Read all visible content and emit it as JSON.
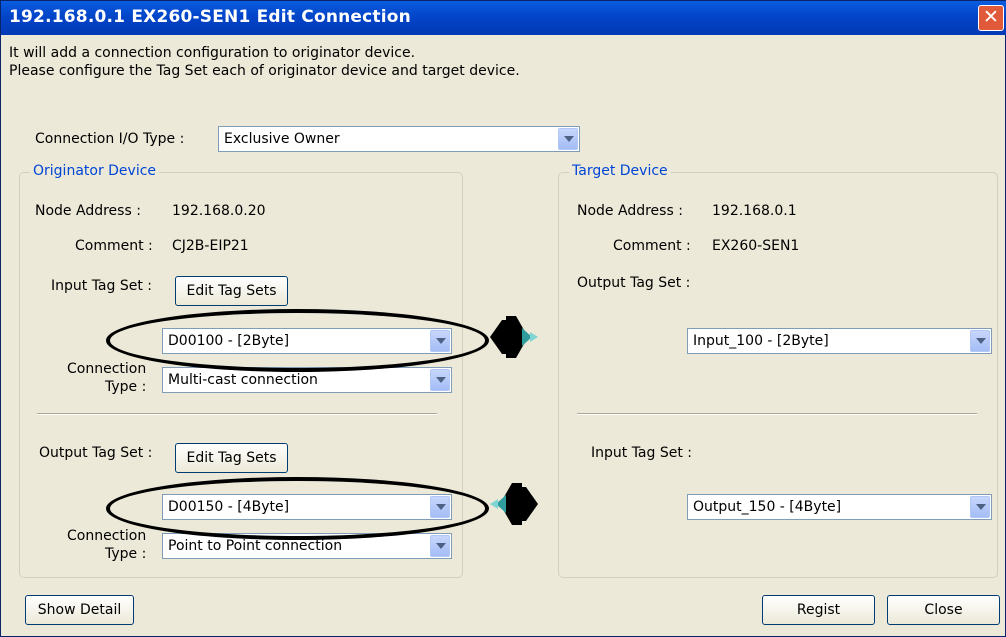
{
  "window": {
    "title": "192.168.0.1 EX260-SEN1 Edit Connection",
    "close_glyph": "✕"
  },
  "intro": {
    "line1": "It will add a connection configuration to originator device.",
    "line2": "Please configure the Tag Set each of originator device and target device."
  },
  "connection_io": {
    "label": "Connection I/O Type :",
    "value": "Exclusive Owner"
  },
  "originator": {
    "title": "Originator Device",
    "node_address_label": "Node Address :",
    "node_address": "192.168.0.20",
    "comment_label": "Comment :",
    "comment": "CJ2B-EIP21",
    "input_tag_set_label": "Input Tag Set :",
    "input_edit_button": "Edit Tag Sets",
    "input_tag_value": "D00100 - [2Byte]",
    "input_conn_type_label1": "Connection",
    "input_conn_type_label2": "Type :",
    "input_conn_type_value": "Multi-cast connection",
    "output_tag_set_label": "Output Tag Set :",
    "output_edit_button": "Edit Tag Sets",
    "output_tag_value": "D00150 - [4Byte]",
    "output_conn_type_label1": "Connection",
    "output_conn_type_label2": "Type :",
    "output_conn_type_value": "Point to Point connection"
  },
  "target": {
    "title": "Target Device",
    "node_address_label": "Node Address :",
    "node_address": "192.168.0.1",
    "comment_label": "Comment :",
    "comment": "EX260-SEN1",
    "output_tag_set_label": "Output Tag Set :",
    "output_tag_value": "Input_100 - [2Byte]",
    "input_tag_set_label": "Input Tag Set :",
    "input_tag_value": "Output_150 - [4Byte]"
  },
  "buttons": {
    "show_detail": "Show Detail",
    "regist": "Regist",
    "close": "Close"
  },
  "icons": {
    "connection_arrow_1": "direction-arrow-icon",
    "connection_arrow_2": "direction-arrow-icon"
  }
}
